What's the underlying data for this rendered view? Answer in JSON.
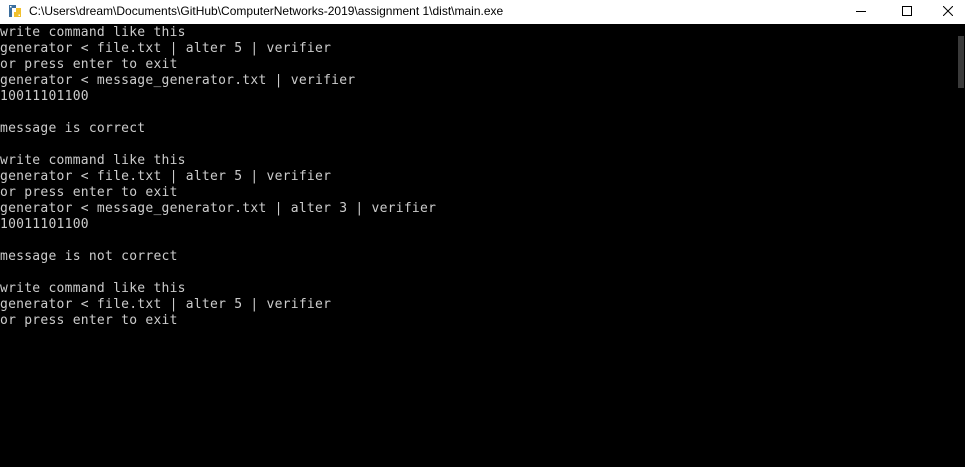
{
  "window": {
    "title": "C:\\Users\\dream\\Documents\\GitHub\\ComputerNetworks-2019\\assignment 1\\dist\\main.exe",
    "app_icon": "python-icon",
    "minimize_icon": "minimize-icon",
    "maximize_icon": "maximize-icon",
    "close_icon": "close-icon"
  },
  "console": {
    "background": "#000000",
    "text_color": "#cccccc",
    "lines": [
      "write command like this",
      "generator < file.txt | alter 5 | verifier",
      "or press enter to exit",
      "generator < message_generator.txt | verifier",
      "10011101100",
      "",
      "message is correct",
      "",
      "write command like this",
      "generator < file.txt | alter 5 | verifier",
      "or press enter to exit",
      "generator < message_generator.txt | alter 3 | verifier",
      "10011101100",
      "",
      "message is not correct",
      "",
      "write command like this",
      "generator < file.txt | alter 5 | verifier",
      "or press enter to exit"
    ]
  }
}
